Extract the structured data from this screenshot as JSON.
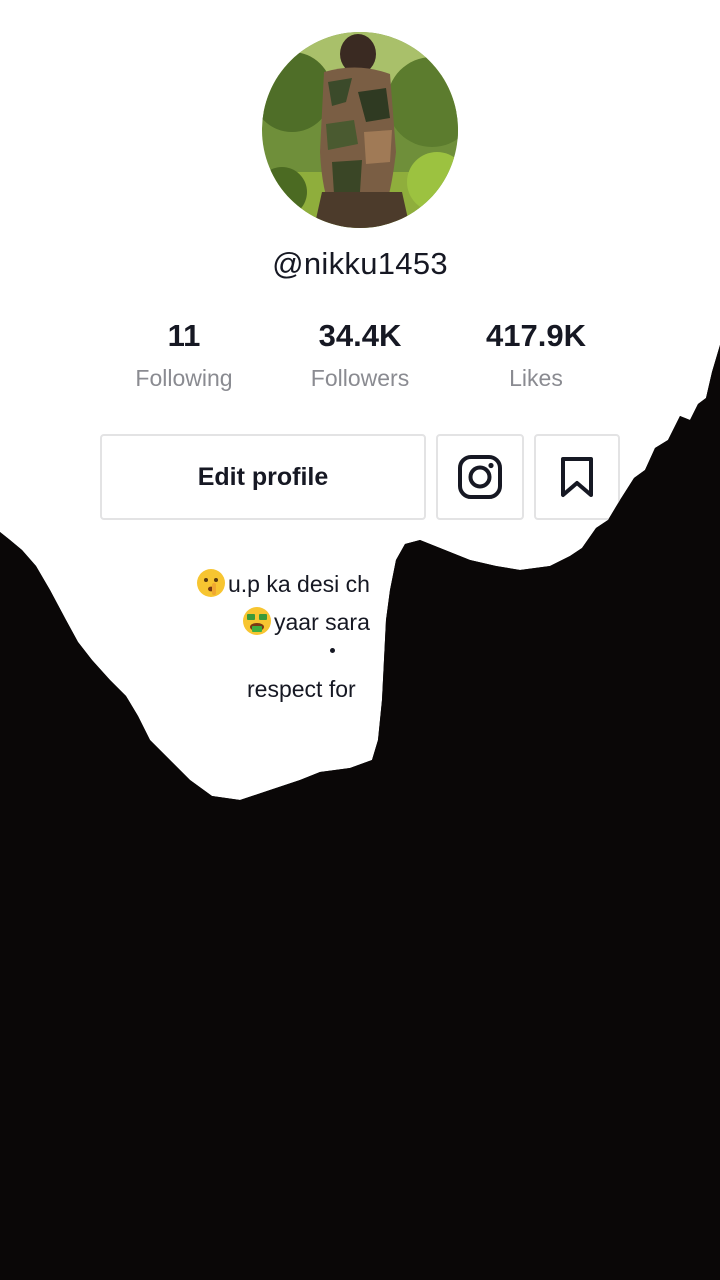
{
  "profile": {
    "username": "@nikku1453",
    "avatar_icon": "profile-photo"
  },
  "stats": {
    "following": {
      "value": "11",
      "label": "Following"
    },
    "followers": {
      "value": "34.4K",
      "label": "Followers"
    },
    "likes": {
      "value": "417.9K",
      "label": "Likes"
    }
  },
  "actions": {
    "edit_profile_label": "Edit profile",
    "instagram_icon": "instagram-icon",
    "bookmark_icon": "bookmark-icon"
  },
  "bio": {
    "line1": "u.p ka desi ch",
    "line1_emoji": "shushing-face",
    "line2": "yaar sara",
    "line2_emoji": "money-mouth-face",
    "line3": "respect for"
  },
  "colors": {
    "text": "#161823",
    "secondary": "#8a8b91",
    "border": "#e3e3e4",
    "overlay": "#0a0707"
  }
}
